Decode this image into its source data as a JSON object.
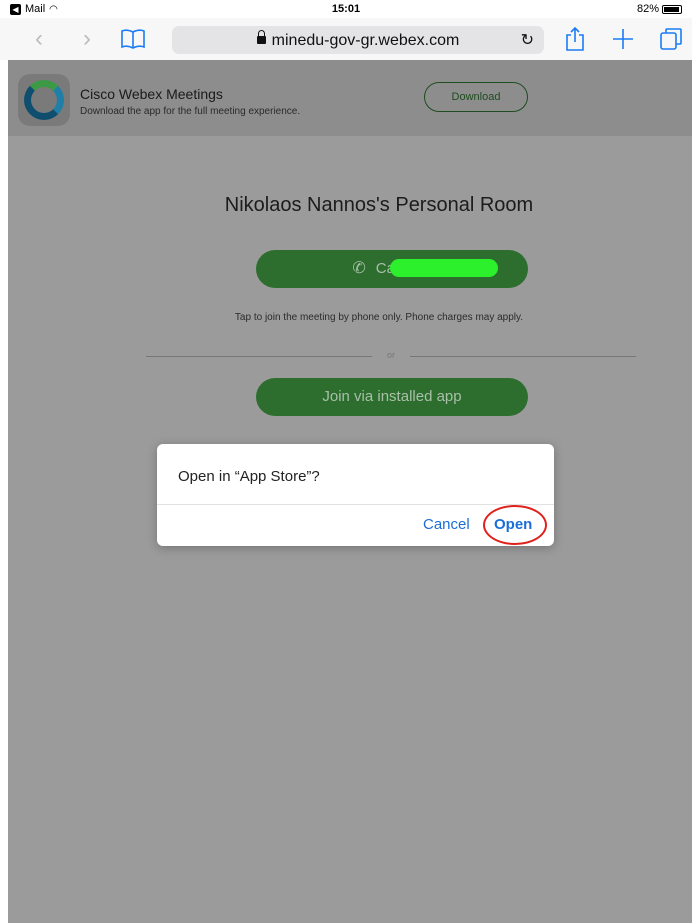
{
  "status_bar": {
    "back_app": "Mail",
    "time": "15:01",
    "battery": "82%"
  },
  "toolbar": {
    "url": "minedu-gov-gr.webex.com"
  },
  "banner": {
    "title": "Cisco Webex Meetings",
    "subtitle": "Download the app for the full meeting experience.",
    "download_label": "Download"
  },
  "main": {
    "room_title": "Nikolaos Nannos's Personal Room",
    "call_label": "Call: 30-",
    "phone_note": "Tap to join the meeting by phone only. Phone charges may apply.",
    "divider_text": "or",
    "join_label": "Join via installed app"
  },
  "dialog": {
    "message": "Open in “App Store”?",
    "cancel_label": "Cancel",
    "open_label": "Open"
  },
  "colors": {
    "accent": "#1a6fd6",
    "button_green": "#2d6e2f",
    "highlight": "#e0201a"
  }
}
